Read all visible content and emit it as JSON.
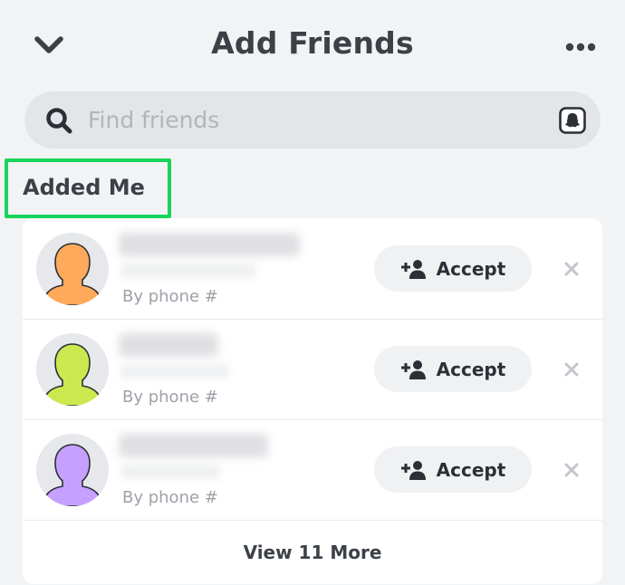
{
  "header": {
    "title": "Add Friends",
    "back_icon": "chevron-down-icon",
    "more_icon": "more-horizontal-icon"
  },
  "search": {
    "placeholder": "Find friends",
    "value": "",
    "icon": "search-icon",
    "right_icon": "snapcode-icon"
  },
  "section": {
    "title": "Added Me",
    "highlight_color": "#19d45a"
  },
  "requests": [
    {
      "source": "By phone #",
      "accept_label": "Accept",
      "avatar_color": "#ffa95a"
    },
    {
      "source": "By phone #",
      "accept_label": "Accept",
      "avatar_color": "#cbe84e"
    },
    {
      "source": "By phone #",
      "accept_label": "Accept",
      "avatar_color": "#c6a0ff"
    }
  ],
  "view_more_label": "View 11 More"
}
